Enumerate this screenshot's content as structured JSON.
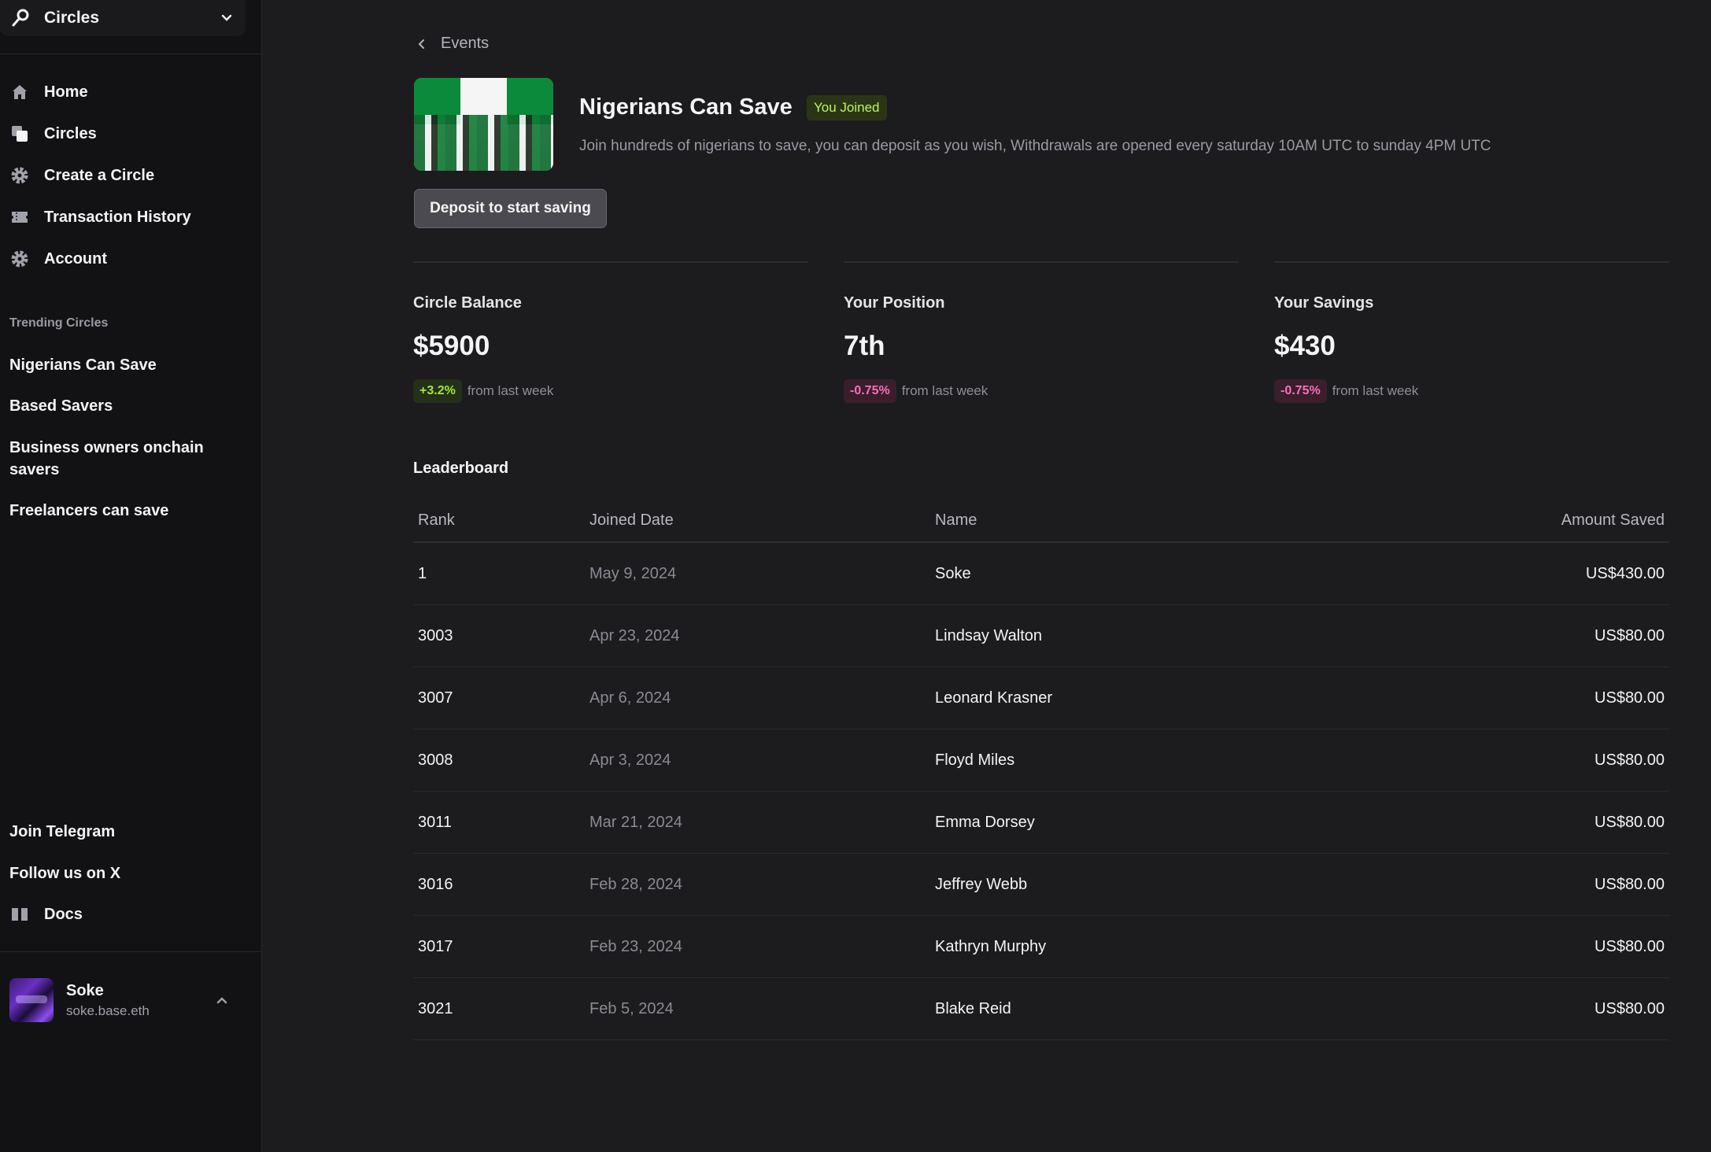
{
  "app": {
    "switcher_label": "Circles"
  },
  "sidebar": {
    "nav": [
      {
        "label": "Home",
        "icon": "home-icon"
      },
      {
        "label": "Circles",
        "icon": "copy-icon"
      },
      {
        "label": "Create a Circle",
        "icon": "gear-icon"
      },
      {
        "label": "Transaction History",
        "icon": "ticket-icon"
      },
      {
        "label": "Account",
        "icon": "gear-icon"
      }
    ],
    "trending_label": "Trending Circles",
    "trending": [
      "Nigerians Can Save",
      "Based Savers",
      "Business owners onchain savers",
      "Freelancers can save"
    ],
    "footer_links": [
      {
        "label": "Join Telegram"
      },
      {
        "label": "Follow us on X"
      },
      {
        "label": "Docs",
        "icon": "book-icon"
      }
    ],
    "user": {
      "name": "Soke",
      "handle": "soke.base.eth"
    }
  },
  "breadcrumb": {
    "back_label": "Events"
  },
  "circle": {
    "title": "Nigerians Can Save",
    "badge": "You Joined",
    "description": "Join hundreds of nigerians to save, you can deposit as you wish, Withdrawals are opened every saturday 10AM UTC to sunday 4PM UTC",
    "deposit_label": "Deposit to start saving"
  },
  "stats": [
    {
      "label": "Circle Balance",
      "value": "$5900",
      "change": "+3.2%",
      "trend": "up",
      "from": "from last week"
    },
    {
      "label": "Your Position",
      "value": "7th",
      "change": "-0.75%",
      "trend": "down",
      "from": "from last week"
    },
    {
      "label": "Your Savings",
      "value": "$430",
      "change": "-0.75%",
      "trend": "down",
      "from": "from last week"
    }
  ],
  "leaderboard": {
    "title": "Leaderboard",
    "columns": [
      "Rank",
      "Joined Date",
      "Name",
      "Amount Saved"
    ],
    "rows": [
      {
        "rank": "1",
        "date": "May 9, 2024",
        "name": "Soke",
        "amount": "US$430.00"
      },
      {
        "rank": "3003",
        "date": "Apr 23, 2024",
        "name": "Lindsay Walton",
        "amount": "US$80.00"
      },
      {
        "rank": "3007",
        "date": "Apr 6, 2024",
        "name": "Leonard Krasner",
        "amount": "US$80.00"
      },
      {
        "rank": "3008",
        "date": "Apr 3, 2024",
        "name": "Floyd Miles",
        "amount": "US$80.00"
      },
      {
        "rank": "3011",
        "date": "Mar 21, 2024",
        "name": "Emma Dorsey",
        "amount": "US$80.00"
      },
      {
        "rank": "3016",
        "date": "Feb 28, 2024",
        "name": "Jeffrey Webb",
        "amount": "US$80.00"
      },
      {
        "rank": "3017",
        "date": "Feb 23, 2024",
        "name": "Kathryn Murphy",
        "amount": "US$80.00"
      },
      {
        "rank": "3021",
        "date": "Feb 5, 2024",
        "name": "Blake Reid",
        "amount": "US$80.00"
      }
    ]
  },
  "colors": {
    "accent_up": "#a3e635",
    "accent_down": "#f472b6",
    "badge_green": "#bef264"
  }
}
